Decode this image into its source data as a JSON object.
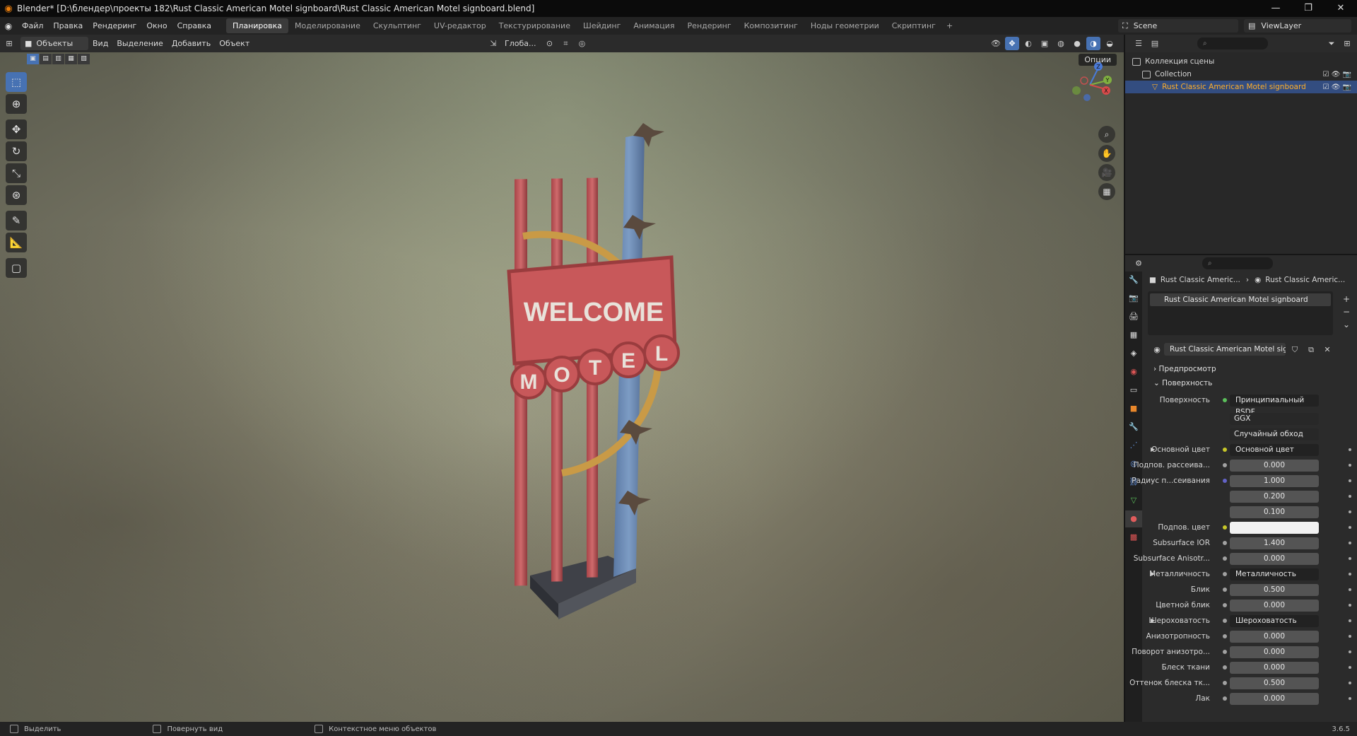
{
  "window": {
    "title": "Blender* [D:\\блендер\\проекты 182\\Rust Classic American Motel signboard\\Rust Classic American Motel signboard.blend]",
    "controls": [
      "—",
      "❐",
      "✕"
    ]
  },
  "menu": {
    "items": [
      "Файл",
      "Правка",
      "Рендеринг",
      "Окно",
      "Справка"
    ],
    "workspaces": [
      "Планировка",
      "Моделирование",
      "Скульптинг",
      "UV-редактор",
      "Текстурирование",
      "Шейдинг",
      "Анимация",
      "Рендеринг",
      "Композитинг",
      "Ноды геометрии",
      "Скриптинг"
    ],
    "active_workspace_index": 0,
    "add": "+",
    "scene": "Scene",
    "view_layer": "ViewLayer"
  },
  "viewport_header": {
    "mode": "Объекты",
    "menus": [
      "Вид",
      "Выделение",
      "Добавить",
      "Объект"
    ],
    "transform_orientation": "Глоба...",
    "options": "Опции"
  },
  "viewport": {
    "sign_text_top": "WELCOME",
    "sign_letters": [
      "M",
      "O",
      "T",
      "E",
      "L"
    ],
    "gizmo_axes": [
      "Z",
      "Y",
      "X"
    ]
  },
  "outliner": {
    "rows": [
      {
        "label": "Коллекция сцены",
        "depth": 0,
        "selected": false
      },
      {
        "label": "Collection",
        "depth": 1,
        "selected": false
      },
      {
        "label": "Rust Classic American Motel signboard",
        "depth": 2,
        "selected": true
      }
    ]
  },
  "properties": {
    "breadcrumb_object": "Rust Classic Americ...",
    "breadcrumb_material": "Rust Classic Americ...",
    "material_slot": "Rust Classic American Motel signboard",
    "material_name": "Rust Classic American Motel signb...",
    "sections": {
      "preview": "Предпросмотр",
      "surface": "Поверхность"
    },
    "surface_label": "Поверхность",
    "surface_value": "Принципиальный BSDF",
    "distribution": "GGX",
    "subsurface_method": "Случайный обход",
    "rows": [
      {
        "label": "Основной цвет",
        "value": "Основной цвет",
        "kind": "link",
        "sock": "#c7c729",
        "tri": true
      },
      {
        "label": "Подпов. рассеива...",
        "value": "0.000",
        "kind": "num",
        "sock": "#a1a1a1"
      },
      {
        "label": "Радиус п...сеивания",
        "value": "1.000",
        "kind": "num",
        "sock": "#6363c7"
      },
      {
        "label": "",
        "value": "0.200",
        "kind": "num",
        "sock": ""
      },
      {
        "label": "",
        "value": "0.100",
        "kind": "num",
        "sock": ""
      },
      {
        "label": "Подпов. цвет",
        "value": "",
        "kind": "color",
        "sock": "#c7c729"
      },
      {
        "label": "Subsurface IOR",
        "value": "1.400",
        "kind": "bar",
        "fill": 0.1,
        "sock": "#a1a1a1"
      },
      {
        "label": "Subsurface Anisotr...",
        "value": "0.000",
        "kind": "num",
        "sock": "#a1a1a1"
      },
      {
        "label": "Металличность",
        "value": "Металличность",
        "kind": "link",
        "sock": "#a1a1a1",
        "tri": true
      },
      {
        "label": "Блик",
        "value": "0.500",
        "kind": "bar",
        "fill": 0.5,
        "sock": "#a1a1a1"
      },
      {
        "label": "Цветной блик",
        "value": "0.000",
        "kind": "num",
        "sock": "#a1a1a1"
      },
      {
        "label": "Шероховатость",
        "value": "Шероховатость",
        "kind": "link",
        "sock": "#a1a1a1",
        "tri": true
      },
      {
        "label": "Анизотропность",
        "value": "0.000",
        "kind": "num",
        "sock": "#a1a1a1"
      },
      {
        "label": "Поворот анизотро...",
        "value": "0.000",
        "kind": "num",
        "sock": "#a1a1a1"
      },
      {
        "label": "Блеск ткани",
        "value": "0.000",
        "kind": "num",
        "sock": "#a1a1a1"
      },
      {
        "label": "Оттенок блеска тк...",
        "value": "0.500",
        "kind": "bar",
        "fill": 0.5,
        "sock": "#a1a1a1"
      },
      {
        "label": "Лак",
        "value": "0.000",
        "kind": "num",
        "sock": "#a1a1a1"
      }
    ]
  },
  "statusbar": {
    "items": [
      "Выделить",
      "Повернуть вид",
      "Контекстное меню объектов"
    ],
    "version": "3.6.5"
  },
  "colors": {
    "accent": "#4772b3",
    "selected_text": "#ffaf29",
    "sign_red": "#c8585a",
    "sign_blue": "#6f8fb8",
    "sign_ring": "#c89a4a"
  }
}
